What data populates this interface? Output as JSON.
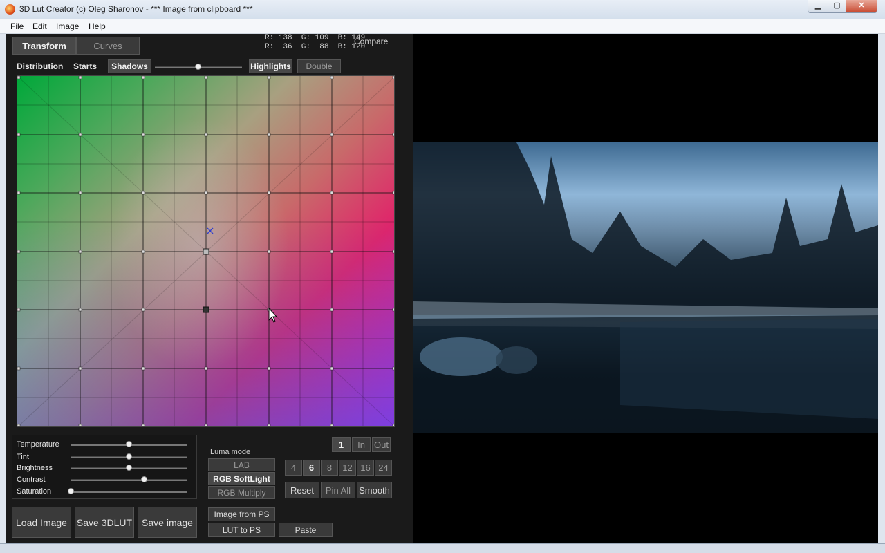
{
  "window": {
    "title": "3D Lut Creator (c) Oleg Sharonov -  *** Image from clipboard ***",
    "min_label": "▁",
    "max_label": "▢",
    "close_label": "✕"
  },
  "menu": [
    "File",
    "Edit",
    "Image",
    "Help"
  ],
  "tabs": {
    "transform": "Transform",
    "curves": "Curves"
  },
  "readout": {
    "line1": "R: 138  G: 109  B: 149",
    "line2": "R:  36  G:  88  B: 120"
  },
  "compare_label": "Compare",
  "grid_toolbar": {
    "distribution": "Distribution",
    "starts": "Starts",
    "shadows": "Shadows",
    "highlights": "Highlights",
    "double": "Double",
    "shadow_highlight_slider": 0.5
  },
  "adjustments": [
    {
      "label": "Temperature",
      "value": 0.5
    },
    {
      "label": "Tint",
      "value": 0.5
    },
    {
      "label": "Brightness",
      "value": 0.5
    },
    {
      "label": "Contrast",
      "value": 0.63
    },
    {
      "label": "Saturation",
      "value": 0.0
    }
  ],
  "luma": {
    "title": "Luma mode",
    "options": [
      "LAB",
      "RGB SoftLight",
      "RGB Multiply"
    ],
    "selected": "RGB SoftLight"
  },
  "view_buttons": [
    "1",
    "In",
    "Out"
  ],
  "grid_sizes": [
    "4",
    "6",
    "8",
    "12",
    "16",
    "24"
  ],
  "grid_size_selected": "6",
  "actions": {
    "reset": "Reset",
    "pin_all": "Pin All",
    "smooth": "Smooth"
  },
  "bottom": {
    "load": "Load Image",
    "save3d": "Save 3DLUT",
    "saveimg": "Save image",
    "from_ps": "Image from PS",
    "to_ps": "LUT to PS",
    "paste": "Paste"
  },
  "icons": {
    "app": "app-logo-icon",
    "cursor": "mouse-pointer-icon",
    "marker": "x-marker-icon"
  }
}
